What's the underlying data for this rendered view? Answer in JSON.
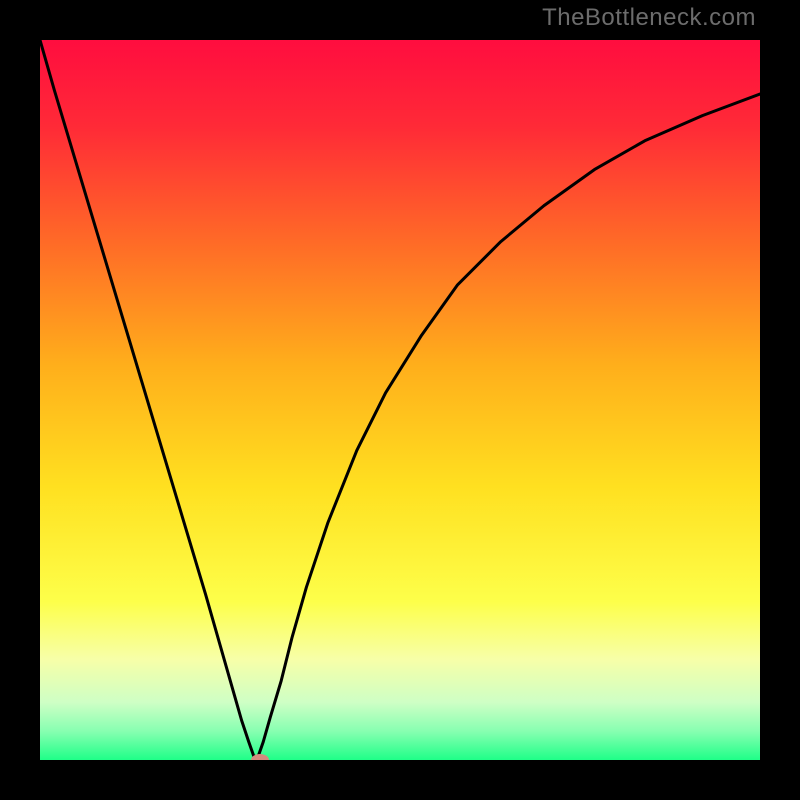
{
  "watermark": "TheBottleneck.com",
  "chart_data": {
    "type": "line",
    "title": "",
    "xlabel": "",
    "ylabel": "",
    "xlim": [
      0,
      100
    ],
    "ylim": [
      0,
      100
    ],
    "background": {
      "type": "vertical-gradient",
      "stops": [
        {
          "pos": 0.0,
          "color": "#ff0d3f"
        },
        {
          "pos": 0.12,
          "color": "#ff2a37"
        },
        {
          "pos": 0.28,
          "color": "#ff6a27"
        },
        {
          "pos": 0.45,
          "color": "#ffae1b"
        },
        {
          "pos": 0.62,
          "color": "#ffe020"
        },
        {
          "pos": 0.78,
          "color": "#fdff4a"
        },
        {
          "pos": 0.86,
          "color": "#f7ffa8"
        },
        {
          "pos": 0.92,
          "color": "#ceffc5"
        },
        {
          "pos": 0.96,
          "color": "#87ffb1"
        },
        {
          "pos": 1.0,
          "color": "#1fff88"
        }
      ]
    },
    "series": [
      {
        "name": "bottleneck-curve",
        "color": "#000000",
        "x": [
          0,
          2,
          5,
          8,
          11,
          14,
          17,
          20,
          23,
          25,
          27,
          28,
          29,
          29.7,
          30.3,
          31,
          32,
          33.5,
          35,
          37,
          40,
          44,
          48,
          53,
          58,
          64,
          70,
          77,
          84,
          92,
          100
        ],
        "y": [
          100,
          93,
          83,
          73,
          63,
          53,
          43,
          33,
          23,
          16,
          9,
          5.5,
          2.5,
          0.5,
          0.5,
          2.5,
          6,
          11,
          17,
          24,
          33,
          43,
          51,
          59,
          66,
          72,
          77,
          82,
          86,
          89.5,
          92.5
        ]
      }
    ],
    "marker": {
      "x": 30.5,
      "y": 0,
      "color": "#d48b7e"
    }
  }
}
